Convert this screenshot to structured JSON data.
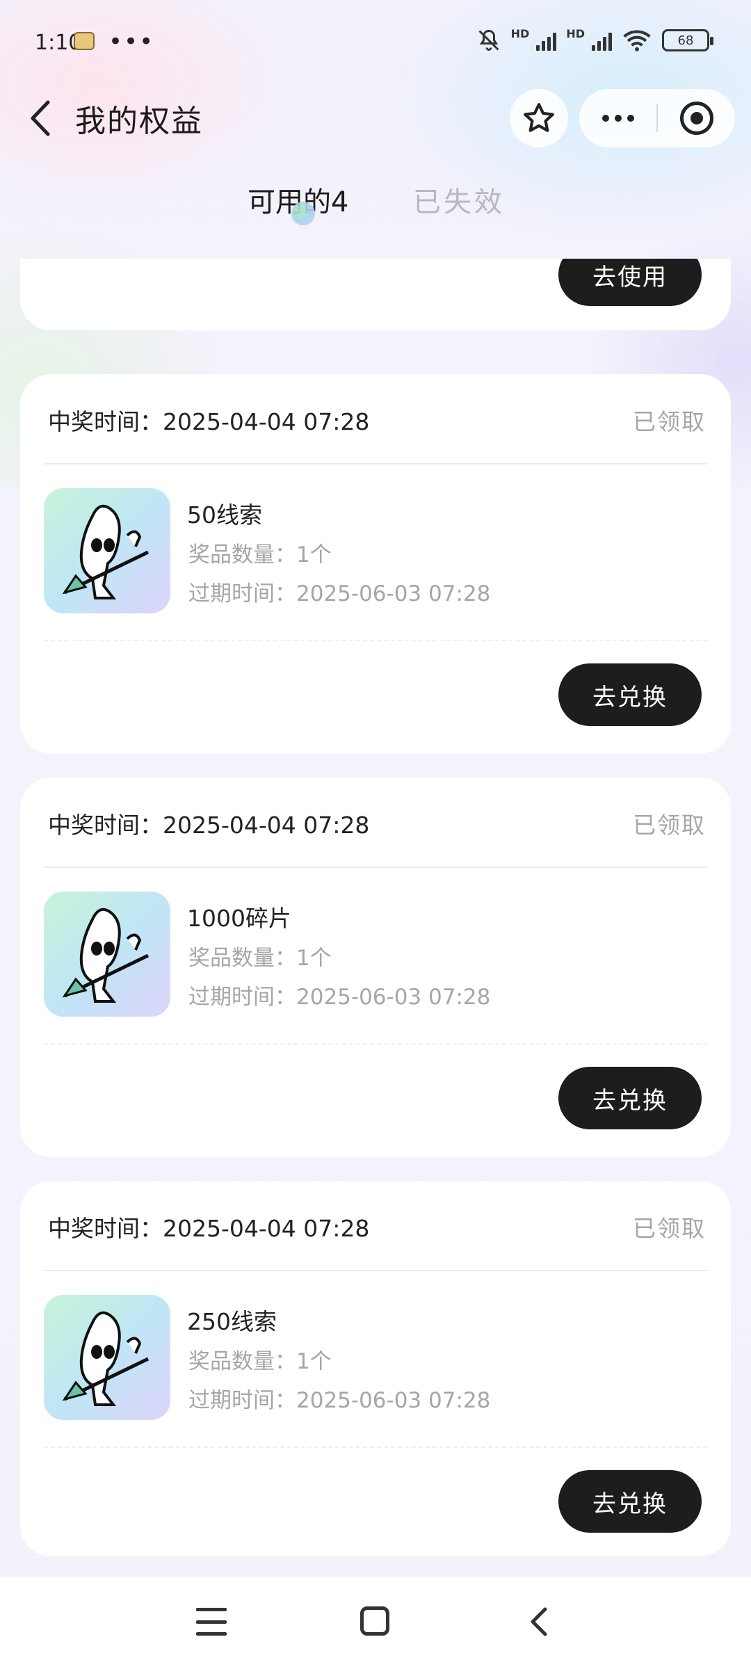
{
  "status_bar": {
    "time": "1:10",
    "dots": "•••",
    "hd1": "HD",
    "hd2": "HD",
    "battery": "68"
  },
  "header": {
    "title": "我的权益"
  },
  "tabs": {
    "available": "可用的4",
    "expired": "已失效"
  },
  "top_card": {
    "action": "去使用"
  },
  "cards": [
    {
      "win_time_label": "中奖时间：2025-04-04 07:28",
      "status": "已领取",
      "prize_name": "50线索",
      "quantity": "奖品数量：1个",
      "expiry": "过期时间：2025-06-03 07:28",
      "action": "去兑换"
    },
    {
      "win_time_label": "中奖时间：2025-04-04 07:28",
      "status": "已领取",
      "prize_name": "1000碎片",
      "quantity": "奖品数量：1个",
      "expiry": "过期时间：2025-06-03 07:28",
      "action": "去兑换"
    },
    {
      "win_time_label": "中奖时间：2025-04-04 07:28",
      "status": "已领取",
      "prize_name": "250线索",
      "quantity": "奖品数量：1个",
      "expiry": "过期时间：2025-06-03 07:28",
      "action": "去兑换"
    }
  ],
  "icons": {
    "back": "chevron-left-icon",
    "star": "star-icon",
    "more": "more-dots-icon",
    "close": "target-close-icon",
    "prize": "guitar-mascot-icon",
    "nav_menu": "menu-icon",
    "nav_home": "home-square-icon",
    "nav_back": "back-chevron-icon"
  },
  "colors": {
    "button_bg": "#1d1d1d",
    "muted_text": "#a6a6a6",
    "inactive_tab": "#b8b8c0"
  }
}
